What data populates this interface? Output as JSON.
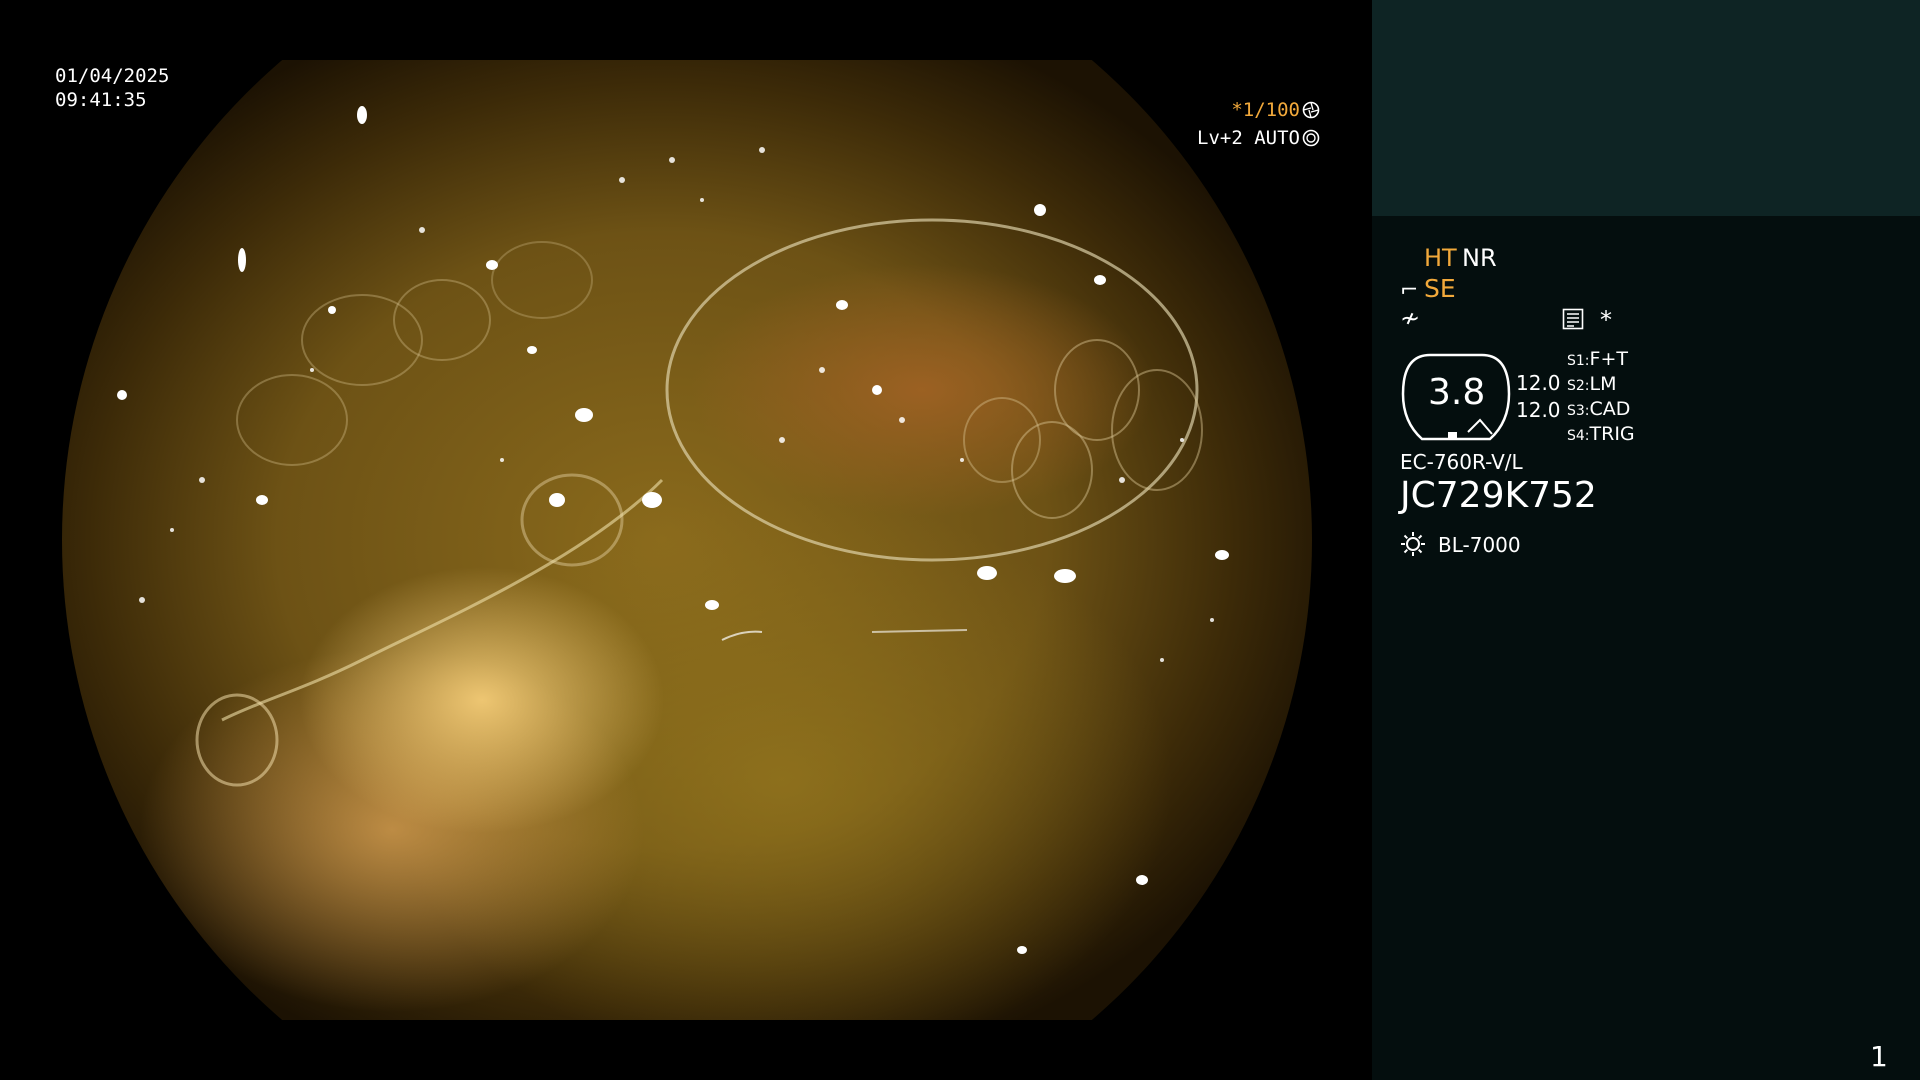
{
  "viewport": {
    "date": "01/04/2025",
    "time": "09:41:35",
    "shutter_prefix": "*",
    "shutter": "1/100",
    "iris": "Lv+2 AUTO"
  },
  "panel": {
    "mode_ht": "HT",
    "mode_nr": "NR",
    "mode_se": "SE",
    "star": "*",
    "zoom": "3.8",
    "value_1": "12.0",
    "value_2": "12.0",
    "switches": [
      {
        "key": "S1:",
        "label": "F+T"
      },
      {
        "key": "S2:",
        "label": "LM"
      },
      {
        "key": "S3:",
        "label": "CAD"
      },
      {
        "key": "S4:",
        "label": "TRIG"
      }
    ],
    "scope_model": "EC-760R-V/L",
    "scope_serial": "JC729K752",
    "light_source": "BL-7000"
  },
  "page_number": "1",
  "colors": {
    "accent_orange": "#f2a93b",
    "panel_bg": "#040e0e",
    "panel_top_bg": "#0e2424"
  },
  "icons": [
    "shutter-icon",
    "iris-icon",
    "se-icon",
    "f-icon",
    "memo-icon",
    "sun-icon"
  ]
}
